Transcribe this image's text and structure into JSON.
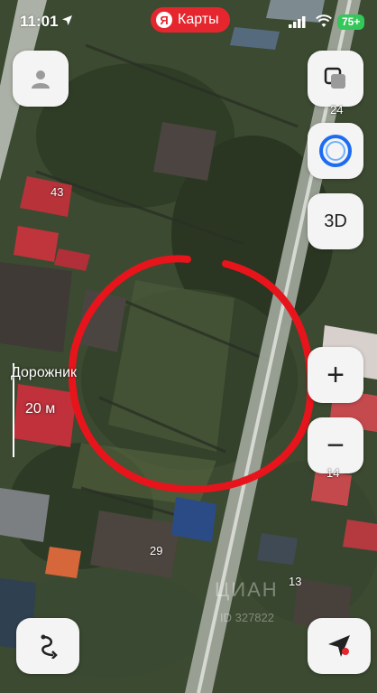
{
  "status_bar": {
    "time": "11:01",
    "app_label": "Карты",
    "yandex_letter": "Я",
    "battery": "75+"
  },
  "controls": {
    "layers_icon": "layers-icon",
    "alice_icon": "alice-icon",
    "mode_3d_label": "3D",
    "zoom_in_label": "+",
    "zoom_out_label": "−",
    "profile_icon": "user-icon",
    "routes_icon": "route-icon",
    "location_icon": "navigation-arrow-icon"
  },
  "scale": {
    "title": "Дорожник",
    "distance": "20 м"
  },
  "map_labels": [
    {
      "id": "house-43",
      "text": "43"
    },
    {
      "id": "house-24",
      "text": "24"
    },
    {
      "id": "house-14",
      "text": "14"
    },
    {
      "id": "house-29",
      "text": "29"
    },
    {
      "id": "house-13",
      "text": "13"
    }
  ],
  "watermark": {
    "line1": "ЦИАН",
    "line2": "ID 327822"
  },
  "colors": {
    "highlight_circle": "#e8141c",
    "pill_red": "#e6262e",
    "battery_green": "#34c759",
    "alice_blue": "#1d6cf2"
  }
}
